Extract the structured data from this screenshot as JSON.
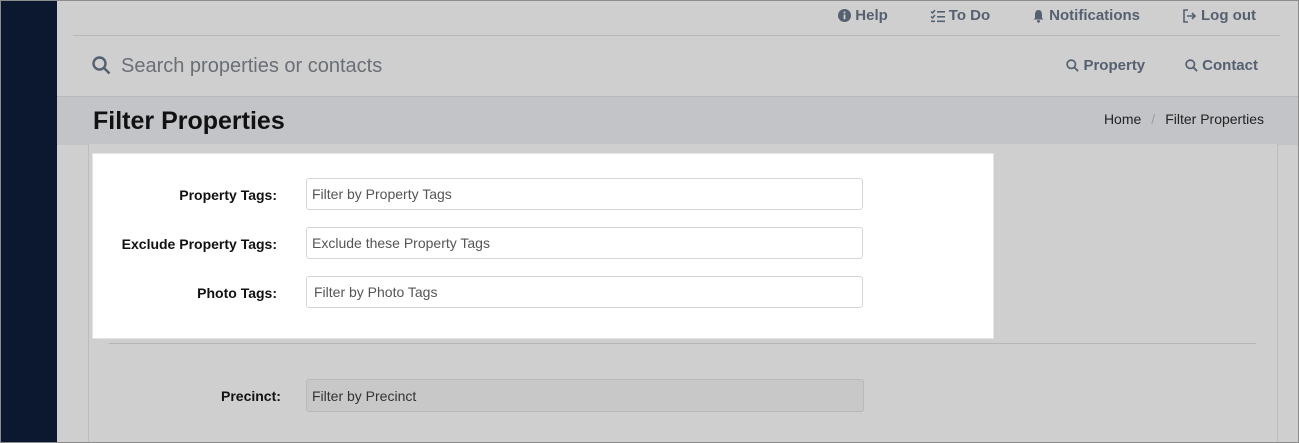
{
  "topnav": {
    "help": "Help",
    "todo": "To Do",
    "notifications": "Notifications",
    "logout": "Log out"
  },
  "search": {
    "placeholder": "Search properties or contacts"
  },
  "quick_search": {
    "property": "Property",
    "contact": "Contact"
  },
  "page": {
    "title": "Filter Properties"
  },
  "breadcrumb": {
    "home": "Home",
    "separator": "/",
    "current": "Filter Properties"
  },
  "filters": {
    "property_tags": {
      "label": "Property Tags:",
      "placeholder": "Filter by Property Tags"
    },
    "exclude_property_tags": {
      "label": "Exclude Property Tags:",
      "placeholder": "Exclude these Property Tags"
    },
    "photo_tags": {
      "label": "Photo Tags:",
      "placeholder": "Filter by Photo Tags"
    },
    "precinct": {
      "label": "Precinct:",
      "placeholder": "Filter by Precinct"
    }
  },
  "colors": {
    "sidebar": "#0b1830",
    "nav_text": "#556070",
    "overlay_bg": "#cfcfcf",
    "panel_bg": "#ffffff"
  },
  "icons": {
    "help": "info-circle-icon",
    "todo": "checklist-icon",
    "notifications": "bell-icon",
    "logout": "logout-icon",
    "search": "search-icon"
  }
}
